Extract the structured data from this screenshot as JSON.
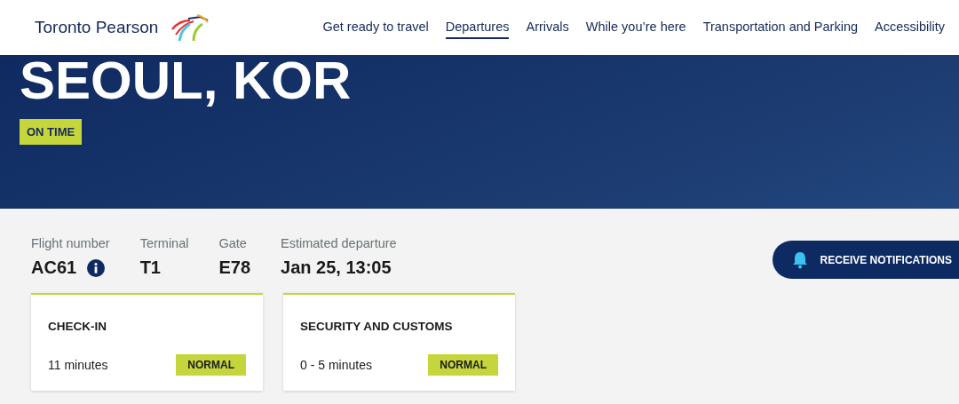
{
  "header": {
    "logo_text": "Toronto Pearson",
    "nav": [
      {
        "label": "Get ready to travel",
        "selected": false
      },
      {
        "label": "Departures",
        "selected": true
      },
      {
        "label": "Arrivals",
        "selected": false
      },
      {
        "label": "While you’re here",
        "selected": false
      },
      {
        "label": "Transportation and Parking",
        "selected": false
      },
      {
        "label": "Accessibility",
        "selected": false
      }
    ]
  },
  "hero": {
    "destination": "SEOUL, KOR",
    "status": "ON TIME"
  },
  "details": [
    {
      "label": "Flight number",
      "value": "AC61",
      "info": true
    },
    {
      "label": "Terminal",
      "value": "T1",
      "info": false
    },
    {
      "label": "Gate",
      "value": "E78",
      "info": false
    },
    {
      "label": "Estimated departure",
      "value": "Jan 25, 13:05",
      "info": false
    }
  ],
  "notify_button": "RECEIVE NOTIFICATIONS",
  "wait_cards": [
    {
      "title": "CHECK-IN",
      "time": "11 minutes",
      "status": "NORMAL"
    },
    {
      "title": "SECURITY AND CUSTOMS",
      "time": "0 - 5 minutes",
      "status": "NORMAL"
    }
  ]
}
